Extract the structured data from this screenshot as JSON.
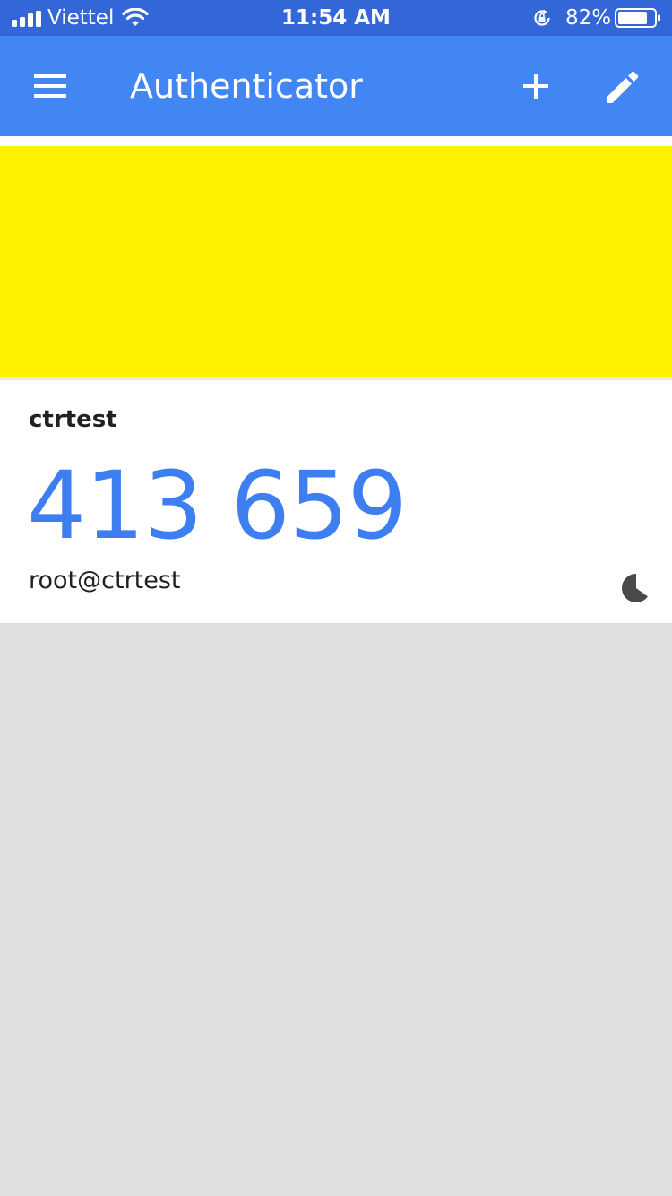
{
  "status_bar": {
    "carrier": "Viettel",
    "time": "11:54 AM",
    "battery_percent": "82%",
    "battery_level": 0.82,
    "signal_bars": 4
  },
  "app_bar": {
    "title": "Authenticator",
    "icons": [
      "menu-icon",
      "plus-icon",
      "pencil-icon"
    ],
    "color": "#4286f3"
  },
  "banner": {
    "color": "#fff200"
  },
  "accounts": [
    {
      "issuer": "ctrtest",
      "code": "413 659",
      "account": "root@ctrtest",
      "timer_remaining_fraction": 0.65,
      "code_color": "#3d7ff1"
    }
  ]
}
